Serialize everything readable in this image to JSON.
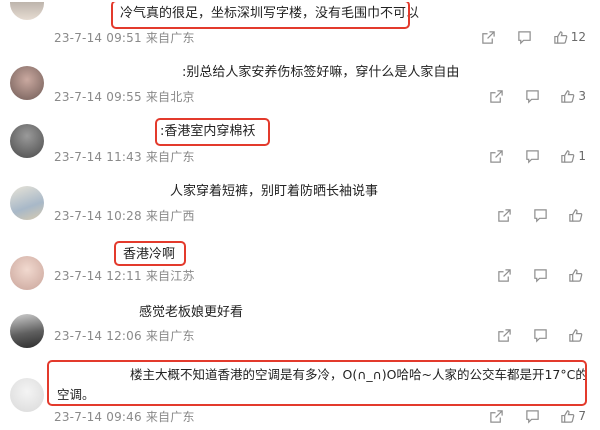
{
  "colors": {
    "highlight": "#e33a2c",
    "meta": "#8a8a8a",
    "text": "#222222"
  },
  "comments": [
    {
      "text": "冷气真的很足，坐标深圳写字楼，没有毛围巾不可以",
      "time": "23-7-14 09:51",
      "location": "来自广东",
      "likes": "12",
      "highlighted": true
    },
    {
      "text": ":别总给人家安养伤标签好嘛，穿什么是人家自由",
      "time": "23-7-14 09:55",
      "location": "来自北京",
      "likes": "3",
      "highlighted": false
    },
    {
      "text": ":香港室内穿棉袄",
      "time": "23-7-14 11:43",
      "location": "来自广东",
      "likes": "1",
      "highlighted": true
    },
    {
      "text": "人家穿着短裤，别盯着防晒长袖说事",
      "time": "23-7-14 10:28",
      "location": "来自广西",
      "likes": "",
      "highlighted": false
    },
    {
      "text": "香港冷啊",
      "time": "23-7-14 12:11",
      "location": "来自江苏",
      "likes": "",
      "highlighted": true
    },
    {
      "text": "感觉老板娘更好看",
      "time": "23-7-14 12:06",
      "location": "来自广东",
      "likes": "",
      "highlighted": false
    },
    {
      "text_line1": "楼主大概不知道香港的空调是有多冷，O(∩_∩)O哈哈~人家的公交车都是开17°C的",
      "text_line2": "空调。",
      "time": "23-7-14 09:46",
      "location": "来自广东",
      "likes": "7",
      "highlighted": true
    }
  ],
  "icons": {
    "share": "share-icon",
    "comment": "comment-icon",
    "like": "thumbs-up-icon"
  }
}
